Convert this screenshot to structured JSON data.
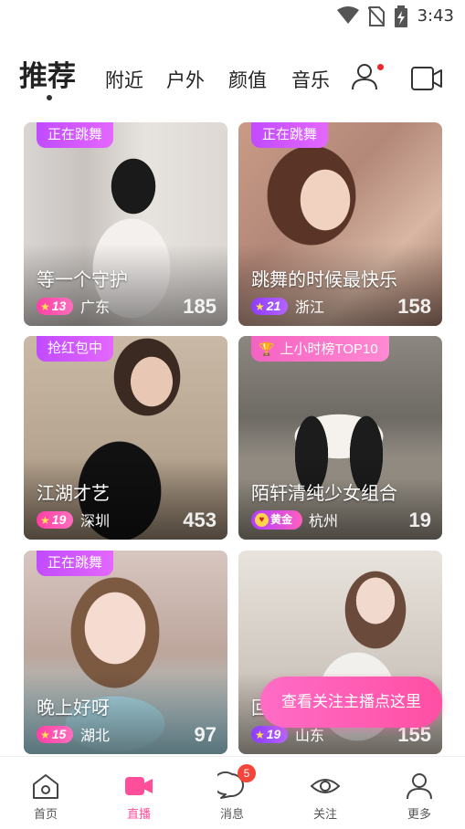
{
  "status_bar": {
    "time": "3:43"
  },
  "tabs": [
    {
      "label": "推荐"
    },
    {
      "label": "附近"
    },
    {
      "label": "户外"
    },
    {
      "label": "颜值"
    },
    {
      "label": "音乐"
    }
  ],
  "cards": [
    {
      "badge": "正在跳舞",
      "title": "等一个守护",
      "level": "13",
      "location": "广东",
      "count": "185"
    },
    {
      "badge": "正在跳舞",
      "title": "跳舞的时候最快乐",
      "level": "21",
      "location": "浙江",
      "count": "158"
    },
    {
      "badge": "抢红包中",
      "title": "江湖才艺",
      "level": "19",
      "location": "深圳",
      "count": "453"
    },
    {
      "badge": "上小时榜TOP10",
      "title": "陌轩清纯少女组合",
      "level_label": "黄金",
      "location": "杭州",
      "count": "19"
    },
    {
      "badge": "正在跳舞",
      "title": "晚上好呀",
      "level": "15",
      "location": "湖北",
      "count": "97"
    },
    {
      "badge": "",
      "title": "回",
      "level": "19",
      "location": "山东",
      "count": "155"
    }
  ],
  "cta": {
    "label": "查看关注主播点这里"
  },
  "bottom_nav": [
    {
      "label": "首页"
    },
    {
      "label": "直播"
    },
    {
      "label": "消息",
      "badge": "5"
    },
    {
      "label": "关注"
    },
    {
      "label": "更多"
    }
  ],
  "colors": {
    "accent": "#ff4f9a",
    "badge_purple": "#c14bff",
    "badge_pink": "#f463c2"
  }
}
